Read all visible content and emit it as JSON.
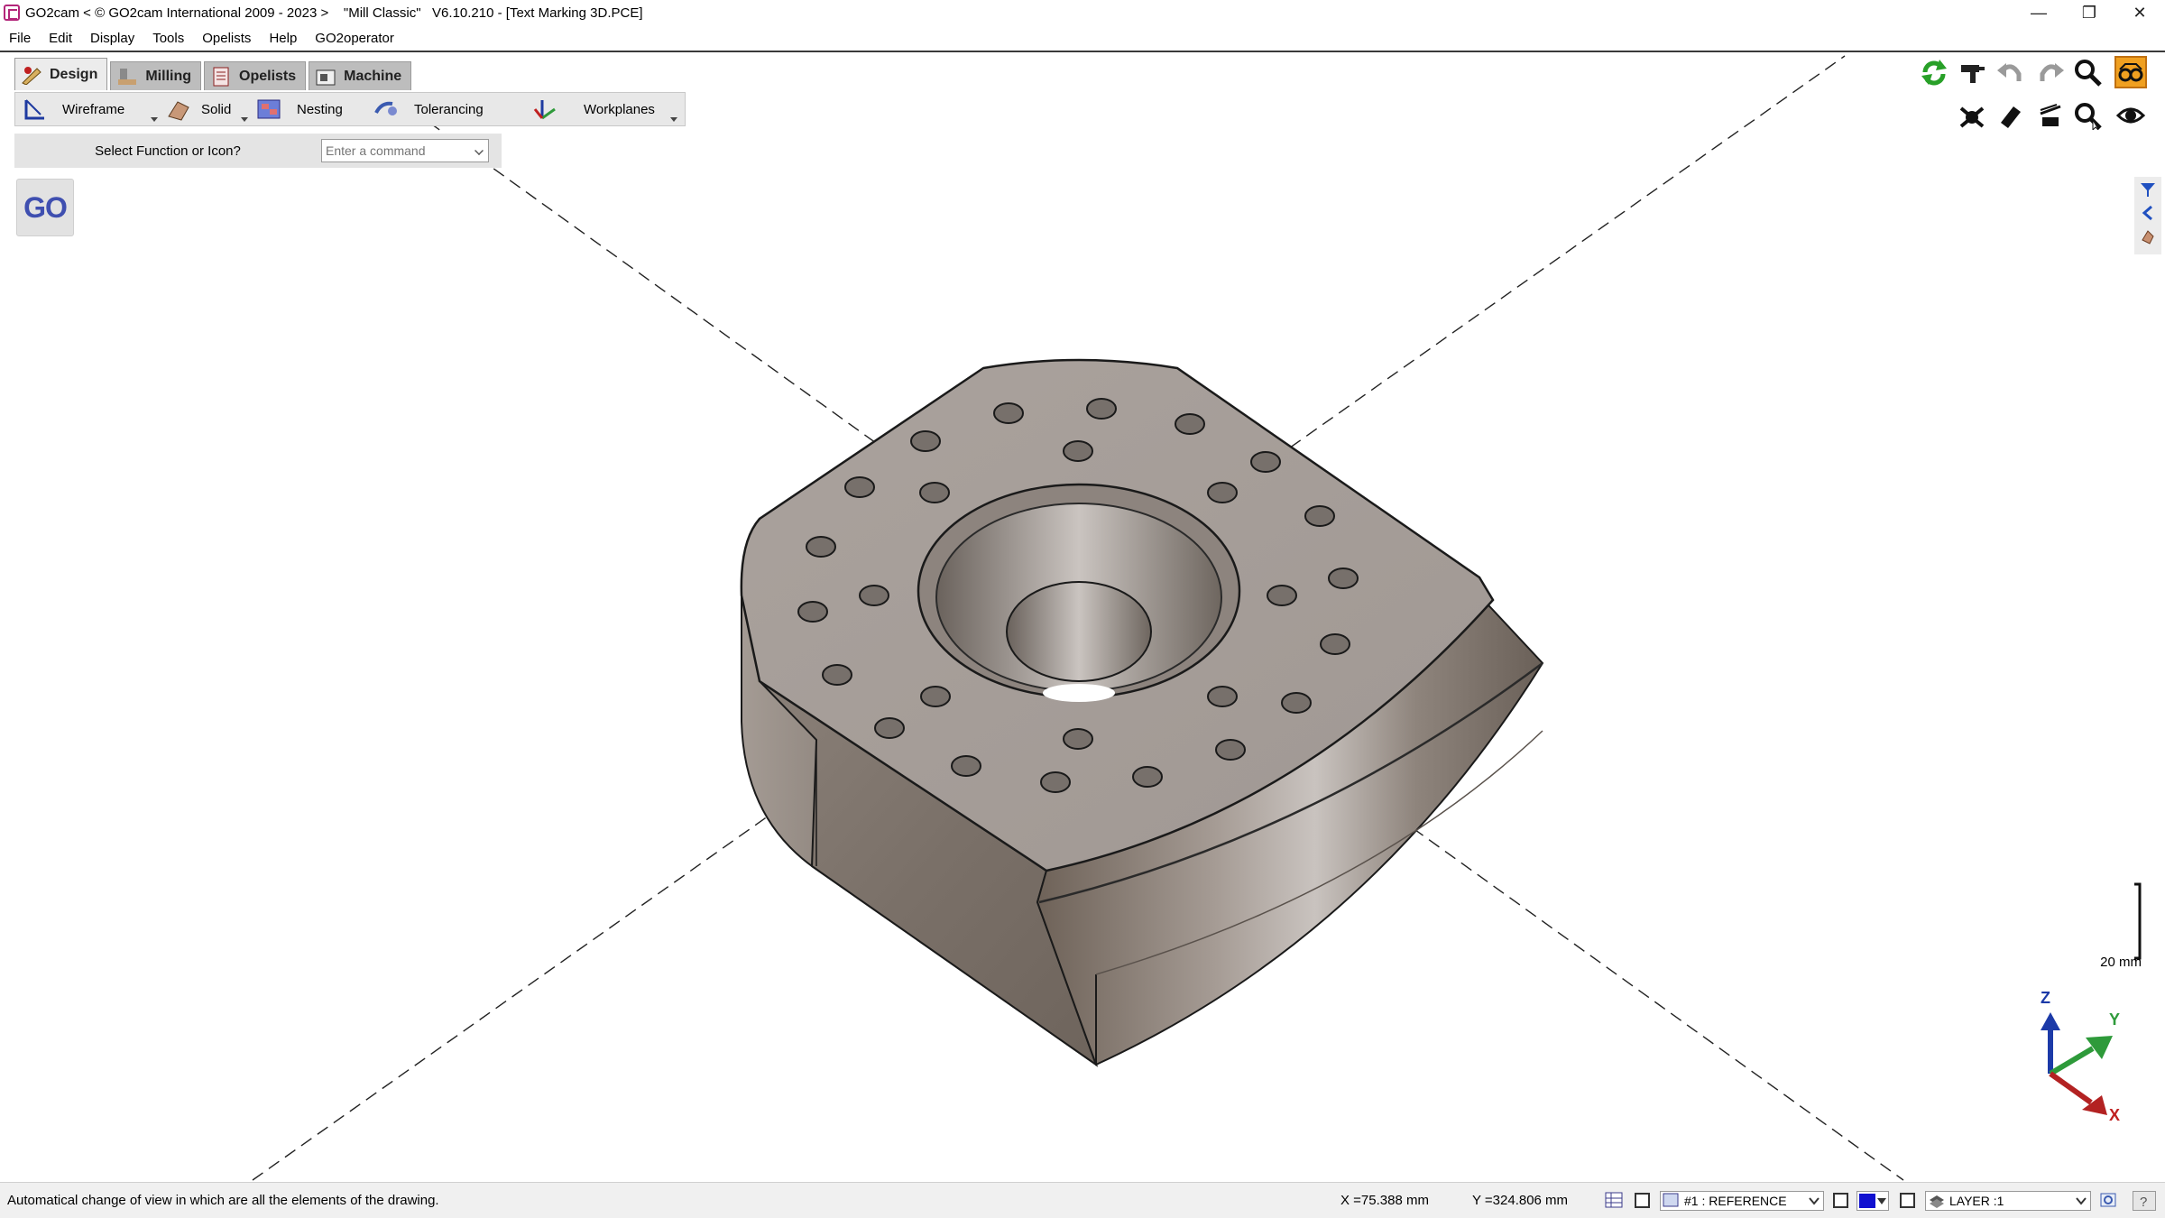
{
  "window": {
    "title": "GO2cam < © GO2cam International 2009 - 2023 >    \"Mill Classic\"   V6.10.210 - [Text Marking 3D.PCE]",
    "minimize": "—",
    "restore": "❐",
    "close": "✕"
  },
  "menu": [
    "File",
    "Edit",
    "Display",
    "Tools",
    "Opelists",
    "Help",
    "GO2operator"
  ],
  "module_tabs": [
    {
      "label": "Design",
      "icon": "design-icon",
      "active": true
    },
    {
      "label": "Milling",
      "icon": "milling-icon",
      "active": false
    },
    {
      "label": "Opelists",
      "icon": "opelists-icon",
      "active": false
    },
    {
      "label": "Machine",
      "icon": "machine-icon",
      "active": false
    }
  ],
  "sub_toolbar": [
    {
      "label": "Wireframe",
      "icon": "wireframe-icon"
    },
    {
      "label": "Solid",
      "icon": "solid-icon"
    },
    {
      "label": "Nesting",
      "icon": "nesting-icon"
    },
    {
      "label": "Tolerancing",
      "icon": "tolerancing-icon"
    },
    {
      "label": "Workplanes",
      "icon": "workplanes-icon"
    }
  ],
  "command": {
    "label": "Select Function or Icon?",
    "placeholder": "Enter a command"
  },
  "go_button": "GO",
  "scale_bar": {
    "label": "20 mm"
  },
  "triad": {
    "z": "Z",
    "y": "Y",
    "x": "X"
  },
  "status": {
    "message": "Automatical change of view in which are all the elements of the drawing.",
    "x": "X =75.388 mm",
    "y": "Y =324.806 mm",
    "reference": "#1 : REFERENCE",
    "layer": "LAYER :1",
    "color": "#1010d0"
  },
  "view_tools": [
    "rotate-view-icon",
    "paint-gun-icon",
    "undo-icon",
    "redo-icon",
    "zoom-icon",
    "glasses-icon",
    "hide-icon",
    "eraser-icon",
    "sweep-icon",
    "zoom-select-icon",
    "eye-icon"
  ],
  "side_tools": [
    "filter-icon",
    "collapse-icon",
    "hand-icon"
  ]
}
